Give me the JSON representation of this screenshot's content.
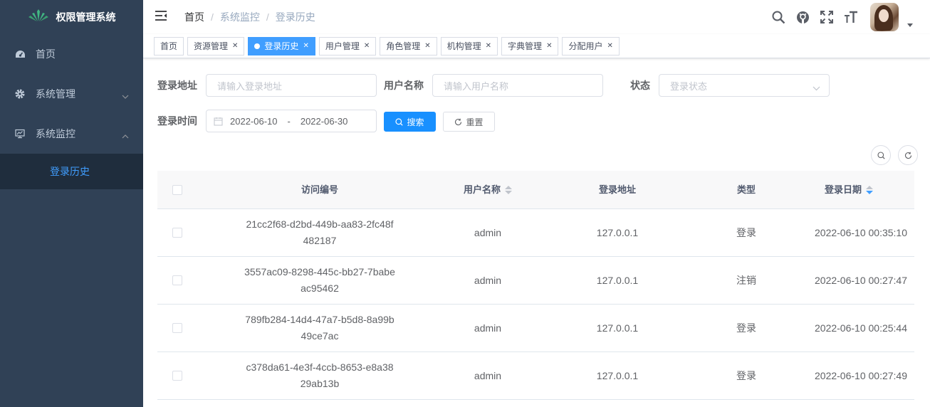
{
  "app": {
    "title": "权限管理系统"
  },
  "sidebar": {
    "items": [
      {
        "label": "首页",
        "icon": "dashboard-icon"
      },
      {
        "label": "系统管理",
        "icon": "gear-icon"
      },
      {
        "label": "系统监控",
        "icon": "monitor-icon"
      }
    ],
    "submenu": {
      "label": "登录历史"
    }
  },
  "breadcrumb": [
    "首页",
    "系统监控",
    "登录历史"
  ],
  "tags": [
    {
      "label": "首页"
    },
    {
      "label": "资源管理"
    },
    {
      "label": "登录历史"
    },
    {
      "label": "用户管理"
    },
    {
      "label": "角色管理"
    },
    {
      "label": "机构管理"
    },
    {
      "label": "字典管理"
    },
    {
      "label": "分配用户"
    }
  ],
  "search": {
    "address_label": "登录地址",
    "address_placeholder": "请输入登录地址",
    "username_label": "用户名称",
    "username_placeholder": "请输入用户名称",
    "status_label": "状态",
    "status_placeholder": "登录状态",
    "time_label": "登录时间",
    "date_start": "2022-06-10",
    "date_sep": "-",
    "date_end": "2022-06-30",
    "search_button": "搜索",
    "reset_button": "重置"
  },
  "table": {
    "columns": [
      "访问编号",
      "用户名称",
      "登录地址",
      "类型",
      "登录日期"
    ],
    "rows": [
      {
        "id1": "21cc2f68-d2bd-449b-aa83-2fc48f",
        "id2": "482187",
        "user": "admin",
        "addr": "127.0.0.1",
        "type": "登录",
        "date": "2022-06-10 00:35:10"
      },
      {
        "id1": "3557ac09-8298-445c-bb27-7babe",
        "id2": "ac95462",
        "user": "admin",
        "addr": "127.0.0.1",
        "type": "注销",
        "date": "2022-06-10 00:27:47"
      },
      {
        "id1": "789fb284-14d4-47a7-b5d8-8a99b",
        "id2": "49ce7ac",
        "user": "admin",
        "addr": "127.0.0.1",
        "type": "登录",
        "date": "2022-06-10 00:25:44"
      },
      {
        "id1": "c378da61-4e3f-4ccb-8653-e8a38",
        "id2": "29ab13b",
        "user": "admin",
        "addr": "127.0.0.1",
        "type": "登录",
        "date": "2022-06-10 00:27:49"
      }
    ]
  },
  "colors": {
    "sidebar_bg": "#304156",
    "submenu_bg": "#1f2d3d",
    "accent": "#409eff",
    "primary_button": "#1890ff"
  }
}
